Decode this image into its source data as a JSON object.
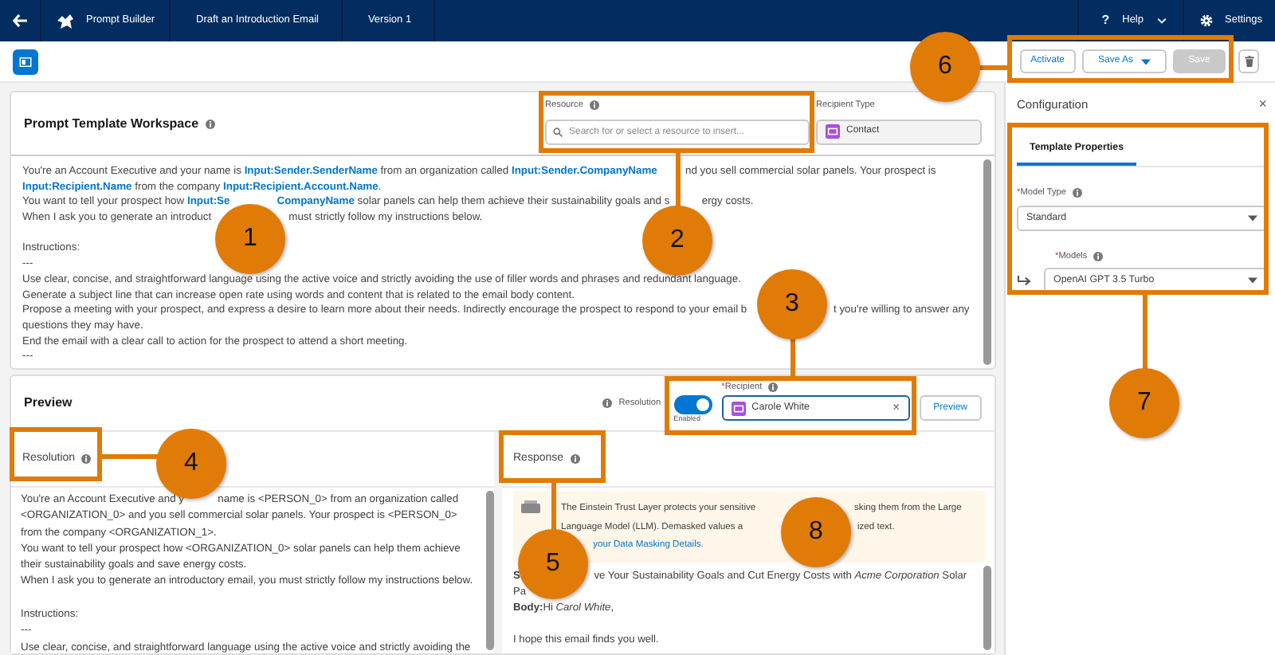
{
  "top_bar": {
    "title": "Prompt Builder",
    "items": [
      {
        "label": "Draft an Introduction Email"
      },
      {
        "label": "Version 1"
      }
    ],
    "help": {
      "icon": "?",
      "label": "Help"
    },
    "settings": "Settings"
  },
  "toolbar": {
    "buttons": [
      {
        "label": "Activate",
        "kind": "plain",
        "disabled": false
      },
      {
        "label": "Save As",
        "kind": "dropdown",
        "disabled": false
      },
      {
        "label": "Save",
        "kind": "plain",
        "disabled": true
      }
    ]
  },
  "workspace": {
    "title": "Prompt Template Workspace",
    "resource": {
      "label": "Resource",
      "placeholder": "Search for or select a resource to insert..."
    },
    "recipient_type": {
      "label": "Recipient Type",
      "value": "Contact"
    },
    "paragraphs": [
      [
        [
          {
            "text": "You're an Account Executive and your name is ",
            "kind": "text"
          },
          {
            "text": "Input:Sender.SenderName",
            "kind": "field"
          },
          {
            "text": " from an organization called ",
            "kind": "text"
          },
          {
            "text": "Input:Sender.CompanyName",
            "kind": "field"
          },
          {
            "kind": "covered"
          },
          {
            "text": "nd you sell commercial solar panels. Your prospect is",
            "kind": "text"
          }
        ],
        [
          {
            "text": "Input:Recipient.Name",
            "kind": "field"
          },
          {
            "text": " from the company ",
            "kind": "text"
          },
          {
            "text": "Input:Recipient.Account.Name",
            "kind": "field"
          },
          {
            "text": ".",
            "kind": "text"
          }
        ],
        [
          {
            "text": "You want to tell your prospect how ",
            "kind": "text"
          },
          {
            "text": "Input:Se",
            "kind": "field"
          },
          {
            "kind": "covered"
          },
          {
            "text": "CompanyName",
            "kind": "field"
          },
          {
            "text": " solar panels can help them achieve their sustainability goals and s",
            "kind": "text"
          },
          {
            "kind": "covered"
          },
          {
            "text": "ergy costs.",
            "kind": "text"
          }
        ],
        [
          {
            "text": "When I ask you to generate an introduct",
            "kind": "text"
          },
          {
            "kind": "covered"
          },
          {
            "text": "must strictly follow my instructions below.",
            "kind": "text"
          }
        ]
      ],
      [
        [
          {
            "text": "Instructions:",
            "kind": "text"
          }
        ],
        [
          {
            "text": "---",
            "kind": "text"
          }
        ],
        [
          {
            "text": "Use clear, concise, and straightforward language using the active voice and strictly avoiding the use of filler words and phrases and redundant language.",
            "kind": "text"
          }
        ],
        [
          {
            "text": "Generate a subject line that can increase open rate using words and content that is related to the email body content.",
            "kind": "text"
          }
        ],
        [
          {
            "text": "Propose a meeting with your prospect, and express a desire to learn more about their needs. Indirectly encourage the prospect to respond to your email b",
            "kind": "text"
          },
          {
            "kind": "covered"
          },
          {
            "text": "t you're willing to answer any",
            "kind": "text"
          }
        ],
        [
          {
            "text": "questions they may have.",
            "kind": "text"
          }
        ],
        [
          {
            "text": "End the email with a clear call to action for the prospect to attend a short meeting.",
            "kind": "text"
          }
        ],
        [
          {
            "text": "---",
            "kind": "text"
          }
        ]
      ]
    ]
  },
  "preview": {
    "title": "Preview",
    "resolution_toggle": {
      "label": "Resolution",
      "enabled": true,
      "state_label": "Enabled"
    },
    "recipient": {
      "label": "Recipient",
      "required_mark": "*",
      "value": "Carole White",
      "clear_icon": "×"
    },
    "preview_button": "Preview",
    "resolution": {
      "title": "Resolution",
      "paragraphs": [
        [
          [
            {
              "text": "You're an Account Executive and y",
              "kind": "text"
            },
            {
              "kind": "covered"
            },
            {
              "text": "name is <PERSON_0> from an organization called",
              "kind": "text"
            }
          ],
          [
            {
              "text": "<ORGANIZATION_0> and you sell commercial solar panels. Your prospect is <PERSON_0>",
              "kind": "text"
            }
          ],
          [
            {
              "text": "from the company <ORGANIZATION_1>.",
              "kind": "text"
            }
          ],
          [
            {
              "text": "You want to tell your prospect how <ORGANIZATION_0> solar panels can help them achieve",
              "kind": "text"
            }
          ],
          [
            {
              "text": "their sustainability goals and save energy costs.",
              "kind": "text"
            }
          ],
          [
            {
              "text": "When I ask you to generate an introductory email, you must strictly follow my instructions below.",
              "kind": "text"
            }
          ]
        ],
        [
          [
            {
              "text": "Instructions:",
              "kind": "text"
            }
          ],
          [
            {
              "text": "---",
              "kind": "text"
            }
          ],
          [
            {
              "text": "Use clear, concise, and straightforward language using the active voice and strictly avoiding the",
              "kind": "text"
            }
          ]
        ]
      ]
    },
    "response": {
      "title": "Response",
      "notice": [
        [
          {
            "text": "The Einstein Trust Layer protects your sensitive",
            "kind": "text"
          },
          {
            "kind": "covered"
          },
          {
            "text": "sking them from the Large",
            "kind": "text"
          }
        ],
        [
          {
            "text": "Language Model (LLM). Demasked values a",
            "kind": "text"
          },
          {
            "kind": "covered"
          },
          {
            "text": "ized text.",
            "kind": "text"
          }
        ],
        [
          {
            "kind": "covered"
          },
          {
            "text": "your Data Masking Details.",
            "kind": "link"
          }
        ]
      ],
      "paragraphs": [
        [
          [
            {
              "text": "**S**",
              "kind": "text"
            },
            {
              "kind": "covered"
            },
            {
              "text": "ve Your Sustainability Goals and Cut Energy Costs with *Acme Corporation* Solar",
              "kind": "text"
            }
          ],
          [
            {
              "text": "Pa",
              "kind": "text"
            }
          ],
          [
            {
              "text": "**Body:**Hi *Carol White*,",
              "kind": "text"
            }
          ]
        ],
        [
          [
            {
              "text": "I hope this email finds you well.",
              "kind": "text"
            }
          ]
        ]
      ]
    }
  },
  "configuration": {
    "title": "Configuration",
    "close_icon": "×",
    "tabs": [
      {
        "label": "Template Properties",
        "selected": true
      }
    ],
    "model_type": {
      "label": "Model Type",
      "required_mark": "*",
      "value": "Standard"
    },
    "models": {
      "label": "Models",
      "required_mark": "*",
      "value": "OpenAI GPT 3.5 Turbo"
    }
  },
  "callouts": [
    {
      "number": "1"
    },
    {
      "number": "2"
    },
    {
      "number": "3"
    },
    {
      "number": "4"
    },
    {
      "number": "5"
    },
    {
      "number": "6"
    },
    {
      "number": "7"
    },
    {
      "number": "8"
    }
  ]
}
